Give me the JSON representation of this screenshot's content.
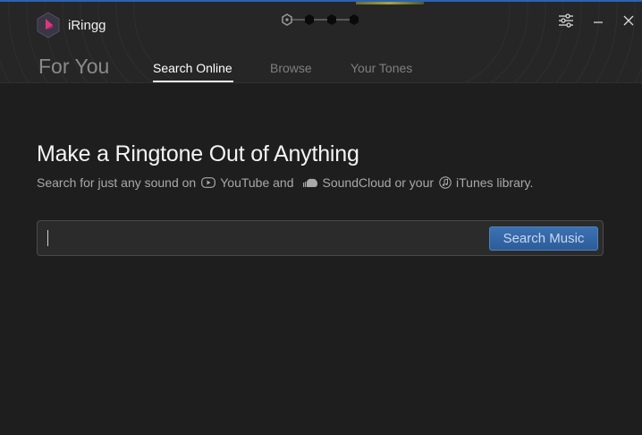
{
  "app": {
    "title": "iRingg"
  },
  "tabs": {
    "for_you": "For You",
    "search_online": "Search Online",
    "browse": "Browse",
    "your_tones": "Your Tones",
    "active": "Search Online"
  },
  "main": {
    "headline": "Make a Ringtone Out of Anything",
    "sub_prefix": "Search for just any sound on",
    "youtube": "YouTube and",
    "soundcloud": "SoundCloud or your",
    "itunes": "iTunes library.",
    "search_value": "",
    "search_button": "Search Music"
  },
  "icons": {
    "logo": "iringg-logo-icon",
    "steps": "progress-steps-icon",
    "settings": "sliders-icon",
    "minimize": "minimize-icon",
    "close": "close-icon",
    "youtube": "youtube-icon",
    "soundcloud": "soundcloud-icon",
    "itunes": "itunes-icon"
  },
  "colors": {
    "background": "#1f1e1f",
    "header": "#262626",
    "accent": "#2d5d99",
    "logo_pink": "#e0367a"
  }
}
